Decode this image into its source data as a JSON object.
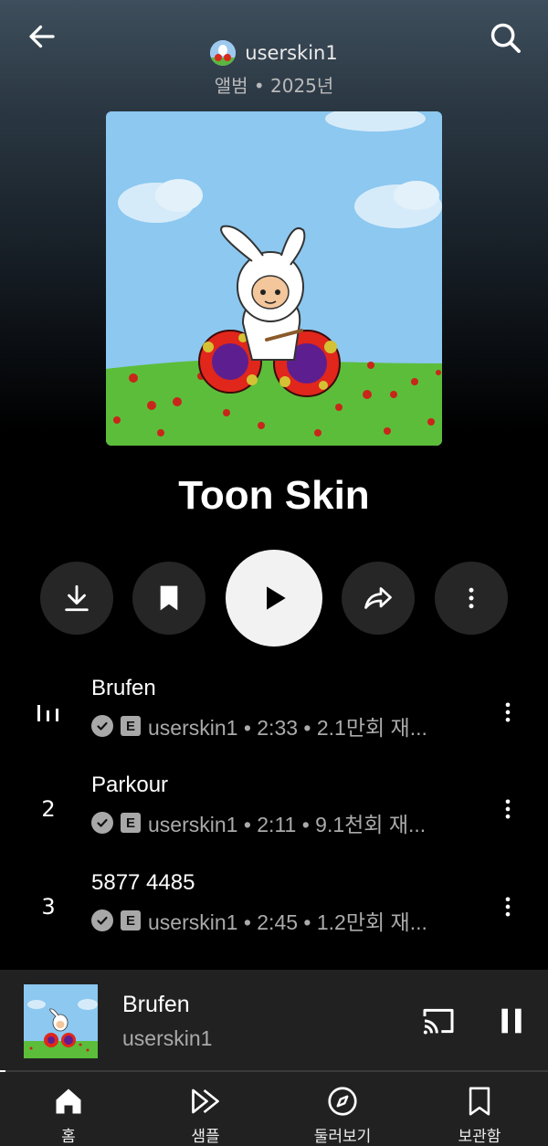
{
  "header": {
    "owner_name": "userskin1",
    "album_meta": "앨범 • 2025년"
  },
  "album": {
    "title": "Toon Skin"
  },
  "actions": {
    "download_icon": "download-icon",
    "save_icon": "bookmark-icon",
    "play_icon": "play-icon",
    "share_icon": "share-icon",
    "more_icon": "more-vertical-icon"
  },
  "tracks": [
    {
      "index": "",
      "now_playing": true,
      "title": "Brufen",
      "subtitle": "userskin1 • 2:33 • 2.1만회 재..."
    },
    {
      "index": "2",
      "now_playing": false,
      "title": "Parkour",
      "subtitle": "userskin1 • 2:11 • 9.1천회 재..."
    },
    {
      "index": "3",
      "now_playing": false,
      "title": "5877 4485",
      "subtitle": "userskin1 • 2:45 • 1.2만회 재..."
    }
  ],
  "explicit_badge": "E",
  "mini_player": {
    "title": "Brufen",
    "artist": "userskin1",
    "progress": 0.01
  },
  "nav": [
    {
      "label": "홈",
      "icon": "home-icon"
    },
    {
      "label": "샘플",
      "icon": "samples-icon"
    },
    {
      "label": "둘러보기",
      "icon": "explore-icon"
    },
    {
      "label": "보관함",
      "icon": "library-icon"
    }
  ],
  "colors": {
    "background": "#000000",
    "surface": "#212121",
    "button": "#262626",
    "play_button": "#f2f2f2",
    "secondary_text": "#aaaaaa"
  }
}
